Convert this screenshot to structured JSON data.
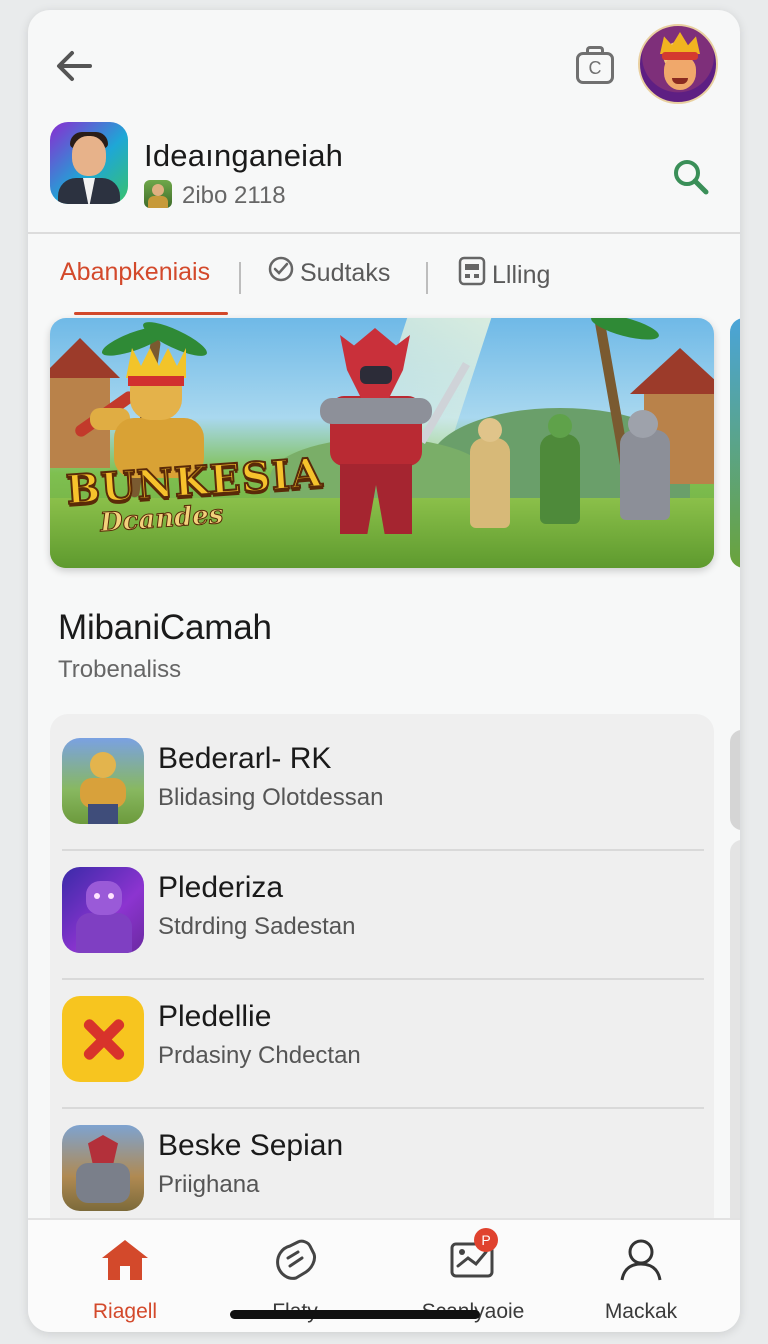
{
  "header": {
    "back_icon": "back-arrow-icon",
    "camera_icon": "camera-icon",
    "camera_glyph": "C"
  },
  "profile": {
    "name": "Ideaınganeiah",
    "sub": "2ibo 2118",
    "search_icon": "search-icon"
  },
  "tabs": [
    {
      "label": "Abanpkeniais",
      "active": true
    },
    {
      "label": "Sudtaks",
      "icon": "check-circle-icon"
    },
    {
      "label": "Llling",
      "icon": "tablet-icon"
    }
  ],
  "banner": {
    "title": "BUNKESIA",
    "subtitle": "Dcandes"
  },
  "section": {
    "title": "MibaniCamah",
    "subtitle": "Trobenaliss"
  },
  "list": [
    {
      "title": "Bederarl- RK",
      "sub": "Blidasing Olotdessan"
    },
    {
      "title": "Plederiza",
      "sub": "Stdrding Sadestan"
    },
    {
      "title": "Pledellie",
      "sub": "Prdasiny Chdectan"
    },
    {
      "title": "Beske Sepian",
      "sub": "Priighana"
    }
  ],
  "bottom_nav": [
    {
      "label": "Riagell",
      "icon": "home-icon",
      "active": true
    },
    {
      "label": "Flaty",
      "icon": "hand-icon"
    },
    {
      "label": "Scanlyaoie",
      "icon": "map-icon",
      "badge": "P"
    },
    {
      "label": "Mackak",
      "icon": "person-icon"
    }
  ],
  "colors": {
    "accent": "#d3492b",
    "search": "#3a8f58",
    "background": "#f7f8f8"
  }
}
